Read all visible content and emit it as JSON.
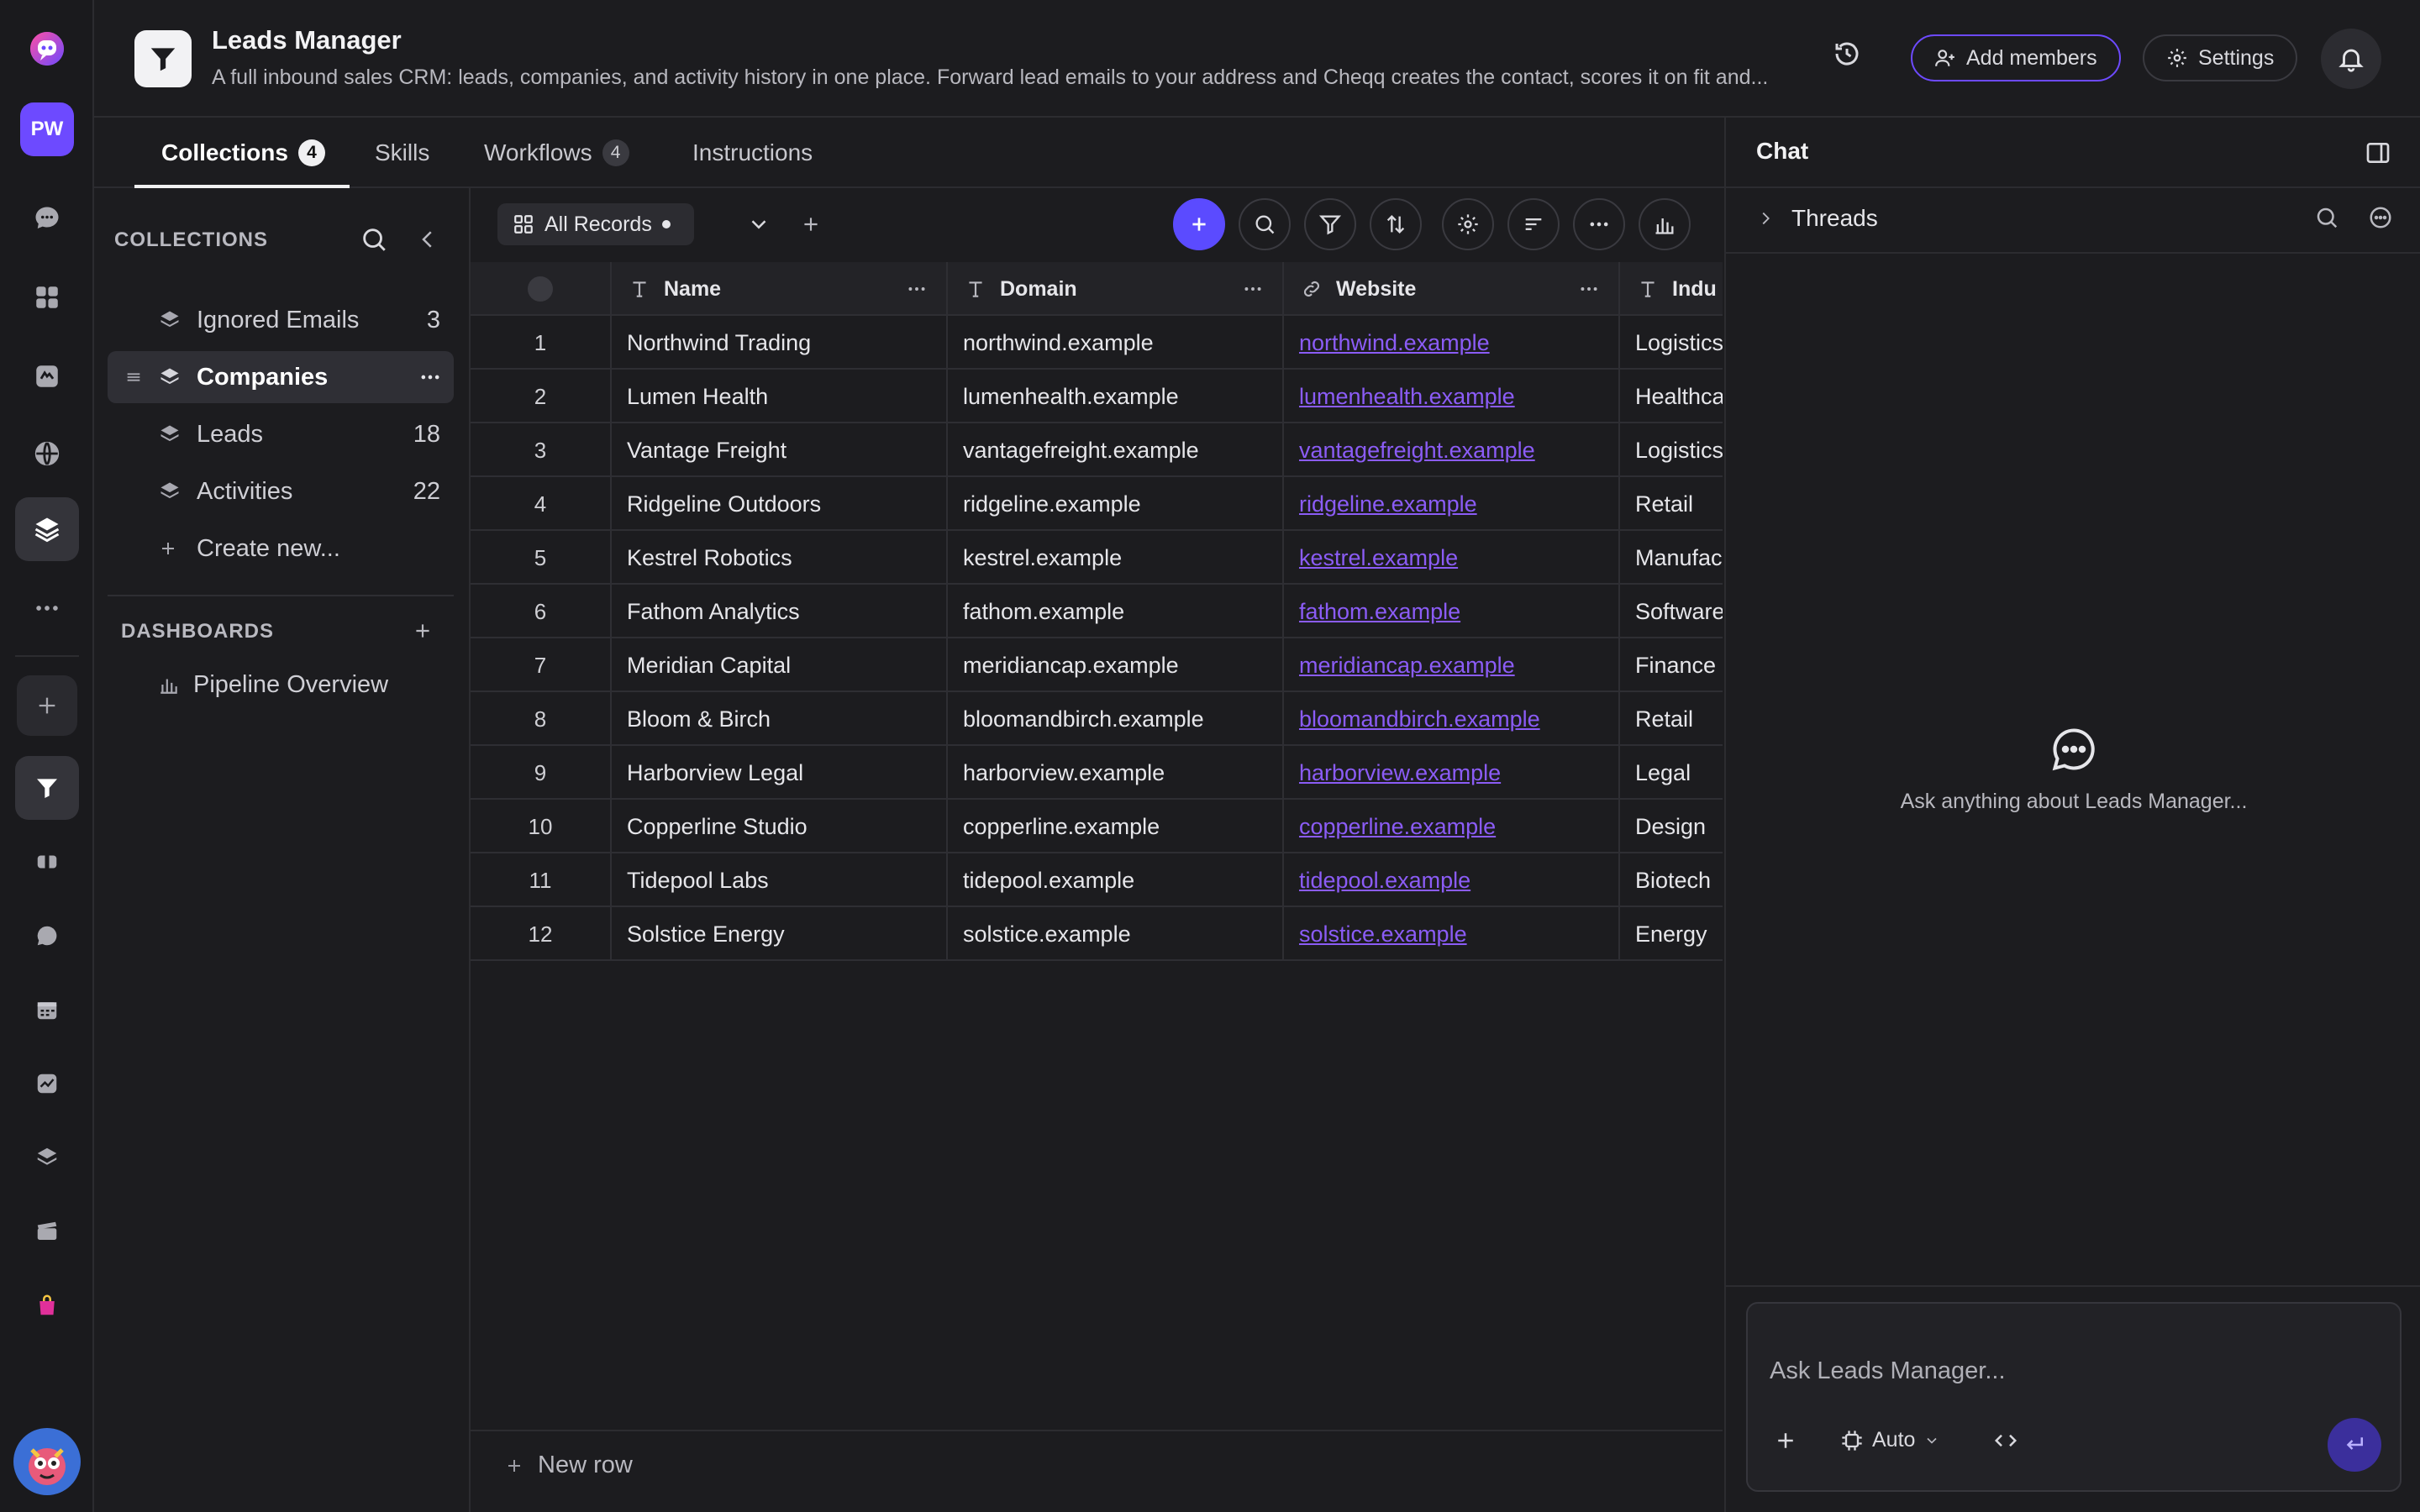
{
  "app": {
    "workspace_initials": "PW",
    "title": "Leads Manager",
    "description": "A full inbound sales CRM: leads, companies, and activity history in one place. Forward lead emails to your address and Cheqq creates the contact, scores it on fit and...",
    "add_members_label": "Add members",
    "settings_label": "Settings"
  },
  "tabs": [
    {
      "label": "Collections",
      "count": "4"
    },
    {
      "label": "Skills",
      "count": ""
    },
    {
      "label": "Workflows",
      "count": "4"
    },
    {
      "label": "Instructions",
      "count": ""
    }
  ],
  "sidebar": {
    "collections_label": "COLLECTIONS",
    "collections": [
      {
        "label": "Ignored Emails",
        "count": "3"
      },
      {
        "label": "Companies",
        "count": ""
      },
      {
        "label": "Leads",
        "count": "18"
      },
      {
        "label": "Activities",
        "count": "22"
      }
    ],
    "create_new_label": "Create new...",
    "dashboards_label": "DASHBOARDS",
    "dashboards": [
      {
        "label": "Pipeline Overview"
      }
    ]
  },
  "toolbar": {
    "view_label": "All Records"
  },
  "table": {
    "columns": [
      "Name",
      "Domain",
      "Website",
      "Indu"
    ],
    "rows": [
      {
        "n": "1",
        "name": "Northwind Trading",
        "domain": "northwind.example",
        "website": "northwind.example",
        "industry": "Logistics"
      },
      {
        "n": "2",
        "name": "Lumen Health",
        "domain": "lumenhealth.example",
        "website": "lumenhealth.example",
        "industry": "Healthca"
      },
      {
        "n": "3",
        "name": "Vantage Freight",
        "domain": "vantagefreight.example",
        "website": "vantagefreight.example",
        "industry": "Logistics"
      },
      {
        "n": "4",
        "name": "Ridgeline Outdoors",
        "domain": "ridgeline.example",
        "website": "ridgeline.example",
        "industry": "Retail"
      },
      {
        "n": "5",
        "name": "Kestrel Robotics",
        "domain": "kestrel.example",
        "website": "kestrel.example",
        "industry": "Manufac"
      },
      {
        "n": "6",
        "name": "Fathom Analytics",
        "domain": "fathom.example",
        "website": "fathom.example",
        "industry": "Software"
      },
      {
        "n": "7",
        "name": "Meridian Capital",
        "domain": "meridiancap.example",
        "website": "meridiancap.example",
        "industry": "Finance"
      },
      {
        "n": "8",
        "name": "Bloom & Birch",
        "domain": "bloomandbirch.example",
        "website": "bloomandbirch.example",
        "industry": "Retail"
      },
      {
        "n": "9",
        "name": "Harborview Legal",
        "domain": "harborview.example",
        "website": "harborview.example",
        "industry": "Legal"
      },
      {
        "n": "10",
        "name": "Copperline Studio",
        "domain": "copperline.example",
        "website": "copperline.example",
        "industry": "Design"
      },
      {
        "n": "11",
        "name": "Tidepool Labs",
        "domain": "tidepool.example",
        "website": "tidepool.example",
        "industry": "Biotech"
      },
      {
        "n": "12",
        "name": "Solstice Energy",
        "domain": "solstice.example",
        "website": "solstice.example",
        "industry": "Energy"
      }
    ],
    "new_row_label": "New row"
  },
  "chat": {
    "title": "Chat",
    "threads_label": "Threads",
    "empty_text": "Ask anything about Leads Manager...",
    "input_placeholder": "Ask Leads Manager...",
    "mode_label": "Auto"
  },
  "colors": {
    "accent": "#6d4aff",
    "link": "#8b5cf6",
    "background": "#1c1c1f"
  }
}
